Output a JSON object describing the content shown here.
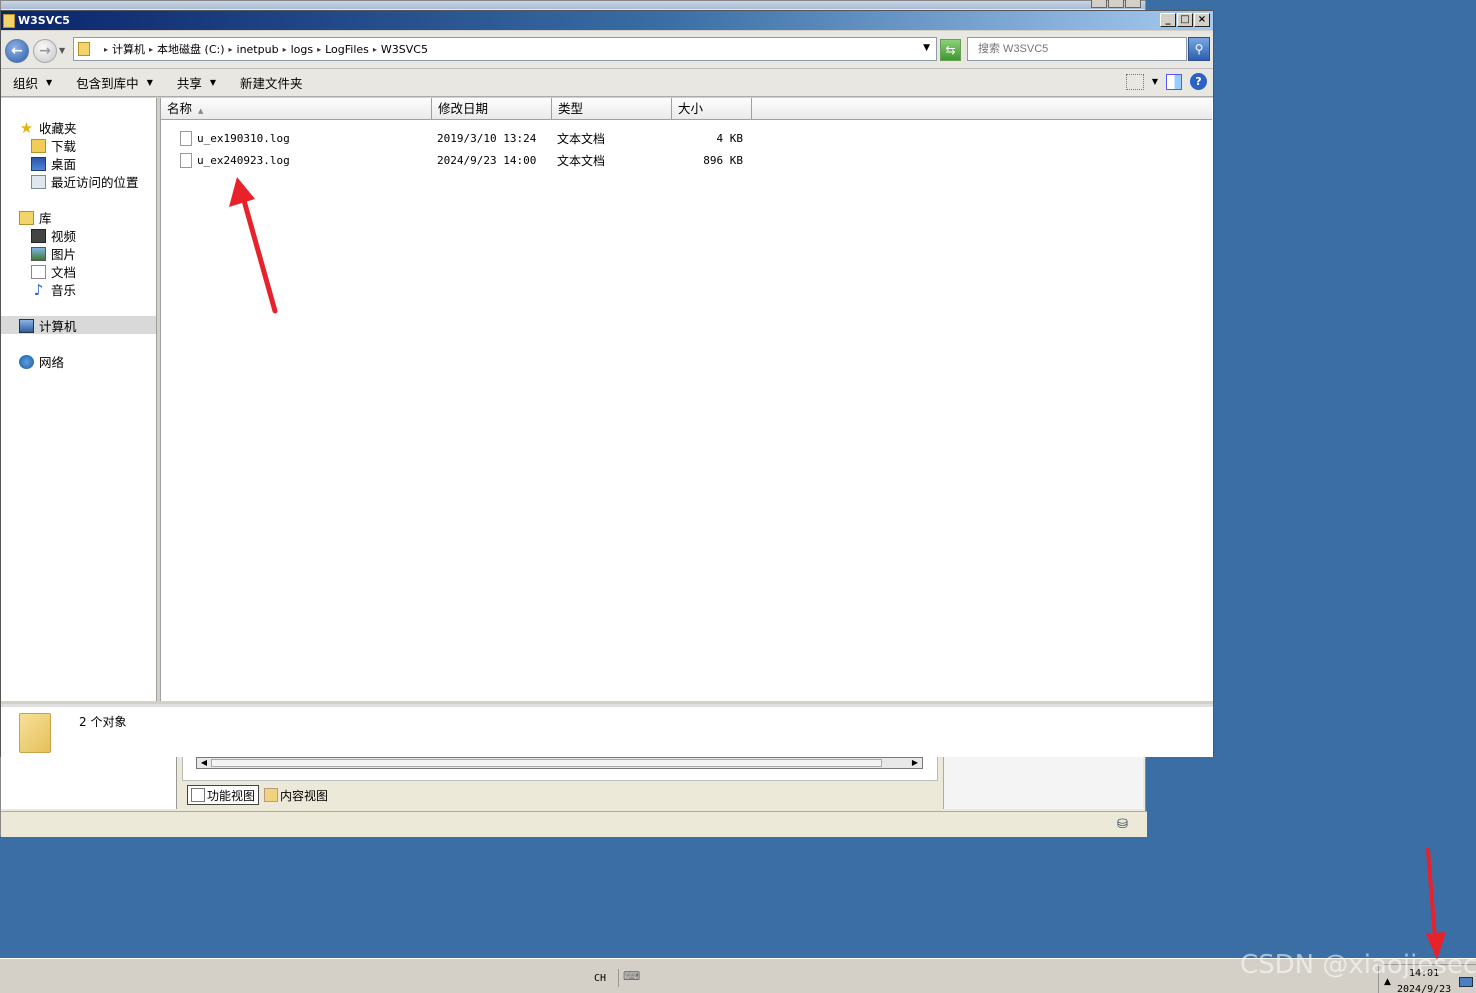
{
  "window": {
    "title": "W3SVC5",
    "controls": [
      "_",
      "□",
      "×"
    ]
  },
  "address": {
    "crumbs": [
      "计算机",
      "本地磁盘 (C:)",
      "inetpub",
      "logs",
      "LogFiles",
      "W3SVC5"
    ],
    "search_placeholder": "搜索 W3SVC5"
  },
  "toolbar": {
    "organize": "组织",
    "include_library": "包含到库中",
    "share": "共享",
    "new_folder": "新建文件夹"
  },
  "nav": {
    "favorites": "收藏夹",
    "downloads": "下载",
    "desktop": "桌面",
    "recent": "最近访问的位置",
    "libraries": "库",
    "videos": "视频",
    "pictures": "图片",
    "documents": "文档",
    "music": "音乐",
    "computer": "计算机",
    "network": "网络"
  },
  "columns": {
    "name": "名称",
    "modified": "修改日期",
    "type": "类型",
    "size": "大小"
  },
  "files": [
    {
      "name": "u_ex190310.log",
      "modified": "2019/3/10 13:24",
      "type": "文本文档",
      "size": "4 KB"
    },
    {
      "name": "u_ex240923.log",
      "modified": "2024/9/23 14:00",
      "type": "文本文档",
      "size": "896 KB"
    }
  ],
  "details": {
    "count": "2 个对象"
  },
  "bg_window": {
    "tab_features": "功能视图",
    "tab_content": "内容视图"
  },
  "taskbar": {
    "lang": "CH",
    "time": "14:01",
    "date": "2024/9/23"
  },
  "watermark": "CSDN @xiaojiesec",
  "colors": {
    "desktop": "#3a6ea5",
    "annotation_arrow": "#e8222a"
  }
}
